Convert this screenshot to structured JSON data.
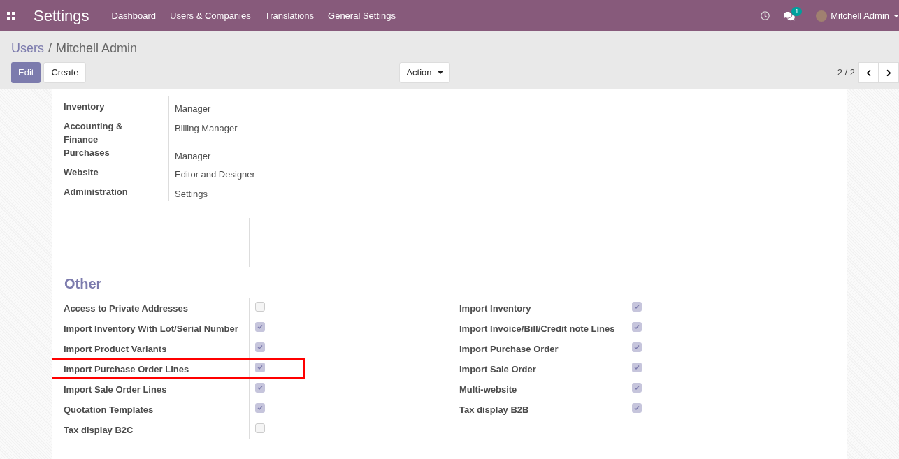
{
  "navbar": {
    "app_title": "Settings",
    "menu": [
      "Dashboard",
      "Users & Companies",
      "Translations",
      "General Settings"
    ],
    "messages_badge": "1",
    "user_name": "Mitchell Admin"
  },
  "control_panel": {
    "breadcrumb_separator": "/",
    "breadcrumb": [
      {
        "label": "Users",
        "link": true
      },
      {
        "label": "Mitchell Admin",
        "link": false
      }
    ],
    "buttons": [
      {
        "label": "Edit",
        "primary": true
      },
      {
        "label": "Create",
        "primary": false
      }
    ],
    "action": "Action",
    "pager": "2 / 2"
  },
  "access_rights": [
    {
      "label": "Inventory",
      "value": "Manager"
    },
    {
      "label": "Accounting & Finance",
      "value": "Billing Manager"
    },
    {
      "label": "Purchases",
      "value": "Manager"
    },
    {
      "label": "Website",
      "value": "Editor and Designer"
    },
    {
      "label": "Administration",
      "value": "Settings"
    }
  ],
  "other": {
    "title": "Other",
    "left": [
      {
        "label": "Access to Private Addresses",
        "checked": false,
        "highlighted": false
      },
      {
        "label": "Import Inventory With Lot/Serial Number",
        "checked": true,
        "highlighted": false
      },
      {
        "label": "Import Product Variants",
        "checked": true,
        "highlighted": false
      },
      {
        "label": "Import Purchase Order Lines",
        "checked": true,
        "highlighted": true
      },
      {
        "label": "Import Sale Order Lines",
        "checked": true,
        "highlighted": false
      },
      {
        "label": "Quotation Templates",
        "checked": true,
        "highlighted": false
      },
      {
        "label": "Tax display B2C",
        "checked": false,
        "highlighted": false
      }
    ],
    "right": [
      {
        "label": "Import Inventory",
        "checked": true,
        "highlighted": false
      },
      {
        "label": "Import Invoice/Bill/Credit note Lines",
        "checked": true,
        "highlighted": false
      },
      {
        "label": "Import Purchase Order",
        "checked": true,
        "highlighted": false
      },
      {
        "label": "Import Sale Order",
        "checked": true,
        "highlighted": false
      },
      {
        "label": "Multi-website",
        "checked": true,
        "highlighted": false
      },
      {
        "label": "Tax display B2B",
        "checked": true,
        "highlighted": false
      }
    ]
  }
}
